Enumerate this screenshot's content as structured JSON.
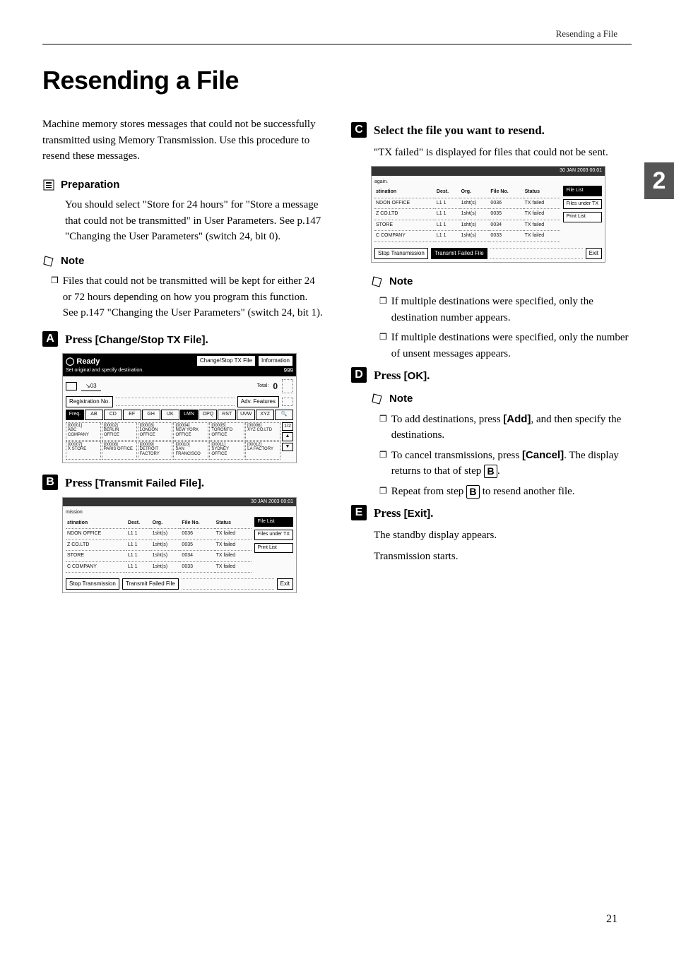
{
  "header": {
    "running_head": "Resending a File"
  },
  "page": {
    "title": "Resending a File",
    "number": "21",
    "side_tab": "2"
  },
  "left": {
    "intro": "Machine memory stores messages that could not be successfully transmitted using Memory Transmission. Use this procedure to resend these messages.",
    "prep_label": "Preparation",
    "prep_body": "You should select \"Store for 24 hours\" for \"Store a message that could not be transmitted\" in User Parameters. See p.147 \"Changing the User Parameters\" (switch 24, bit 0).",
    "note_label": "Note",
    "note_body": "Files that could not be transmitted will be kept for either 24 or 72 hours depending on how you program this function. See p.147 \"Changing the User Parameters\" (switch 24, bit 1).",
    "step1_prefix": "Press ",
    "step1_btn": "[Change/Stop TX File]",
    "step1_suffix": ".",
    "step2_prefix": "Press ",
    "step2_btn": "[Transmit Failed File]",
    "step2_suffix": "."
  },
  "right": {
    "step3_text": "Select the file you want to resend.",
    "step3_sub": "\"TX failed\" is displayed for files that could not be sent.",
    "note_label": "Note",
    "note3_a": "If multiple destinations were specified, only the destination number appears.",
    "note3_b": "If multiple destinations were specified, only the number of unsent messages appears.",
    "step4_prefix": "Press ",
    "step4_btn": "[OK]",
    "step4_suffix": ".",
    "note4_label": "Note",
    "note4_a_pre": "To add destinations, press ",
    "note4_a_btn": "[Add]",
    "note4_a_post": ", and then specify the destinations.",
    "note4_b_pre": "To cancel transmissions, press ",
    "note4_b_btn": "[Cancel]",
    "note4_b_post": ". The display returns to that of step ",
    "note4_b_stepref": "B",
    "note4_b_end": ".",
    "note4_c_pre": "Repeat from step ",
    "note4_c_stepref": "B",
    "note4_c_post": " to resend another file.",
    "step5_prefix": "Press ",
    "step5_btn": "[Exit]",
    "step5_suffix": ".",
    "step5_sub1": "The standby display appears.",
    "step5_sub2": "Transmission starts."
  },
  "ss1": {
    "ready": "Ready",
    "subtitle": "Set original and specify destination.",
    "btn_change": "Change/Stop TX File",
    "btn_info": "Information",
    "count": "999",
    "entered": "03",
    "total_label": "Total:",
    "total_val": "0",
    "reg_label": "Registration No.",
    "adv_label": "Adv. Features",
    "tabs": [
      "Freq.",
      "AB",
      "CD",
      "EF",
      "GH",
      "IJK",
      "LMN",
      "OPQ",
      "RST",
      "UVW",
      "XYZ"
    ],
    "cells": [
      {
        "id": "[00001]",
        "name": "ABC COMPANY"
      },
      {
        "id": "[00002]",
        "name": "BERLIN OFFICE"
      },
      {
        "id": "[00003]",
        "name": "LONDON OFFICE"
      },
      {
        "id": "[00004]",
        "name": "NEW YORK OFFICE"
      },
      {
        "id": "[00005]",
        "name": "TORONTO OFFICE"
      },
      {
        "id": "[00006]",
        "name": "XYZ CO.LTD"
      },
      {
        "id": "[00007]",
        "name": "X STORE"
      },
      {
        "id": "[00008]",
        "name": "PARIS OFFICE"
      },
      {
        "id": "[00009]",
        "name": "DETROIT FACTORY"
      },
      {
        "id": "[00010]",
        "name": "SAN FRANCISCO"
      },
      {
        "id": "[00011]",
        "name": "SYDNEY OFFICE"
      },
      {
        "id": "[00012]",
        "name": "LA FACTORY"
      }
    ],
    "page_ind": "1/2"
  },
  "ss2": {
    "date": "30 JAN 2003 00:01",
    "top_word": "mission",
    "cols": [
      "stination",
      "Dest.",
      "Org.",
      "File No.",
      "Status"
    ],
    "rows": [
      {
        "d": "NDON OFFICE",
        "dest": "L1 1",
        "org": "1sht(s)",
        "file": "0036",
        "st": "TX failed"
      },
      {
        "d": "Z CO.LTD",
        "dest": "L1 1",
        "org": "1sht(s)",
        "file": "0035",
        "st": "TX failed"
      },
      {
        "d": "STORE",
        "dest": "L1 1",
        "org": "1sht(s)",
        "file": "0034",
        "st": "TX failed"
      },
      {
        "d": "C COMPANY",
        "dest": "L1 1",
        "org": "1sht(s)",
        "file": "0033",
        "st": "TX failed"
      }
    ],
    "btn_filelist": "File List",
    "btn_filesunder": "Files under TX",
    "btn_printlist": "Print List",
    "btn_stop": "Stop Transmission",
    "btn_tff": "Transmit Failed File",
    "btn_exit": "Exit"
  },
  "ss3": {
    "date": "30 JAN 2003 00:01",
    "top_word": "again.",
    "cols": [
      "stination",
      "Dest.",
      "Org.",
      "File No.",
      "Status"
    ],
    "rows": [
      {
        "d": "NDON OFFICE",
        "dest": "L1 1",
        "org": "1sht(s)",
        "file": "0036",
        "st": "TX failed"
      },
      {
        "d": "Z CO.LTD",
        "dest": "L1 1",
        "org": "1sht(s)",
        "file": "0035",
        "st": "TX failed"
      },
      {
        "d": "STORE",
        "dest": "L1 1",
        "org": "1sht(s)",
        "file": "0034",
        "st": "TX failed"
      },
      {
        "d": "C COMPANY",
        "dest": "L1 1",
        "org": "1sht(s)",
        "file": "0033",
        "st": "TX failed"
      }
    ],
    "btn_filelist": "File List",
    "btn_filesunder": "Files under TX",
    "btn_printlist": "Print List",
    "btn_stop": "Stop Transmission",
    "btn_tff": "Transmit Failed File",
    "btn_exit": "Exit"
  }
}
